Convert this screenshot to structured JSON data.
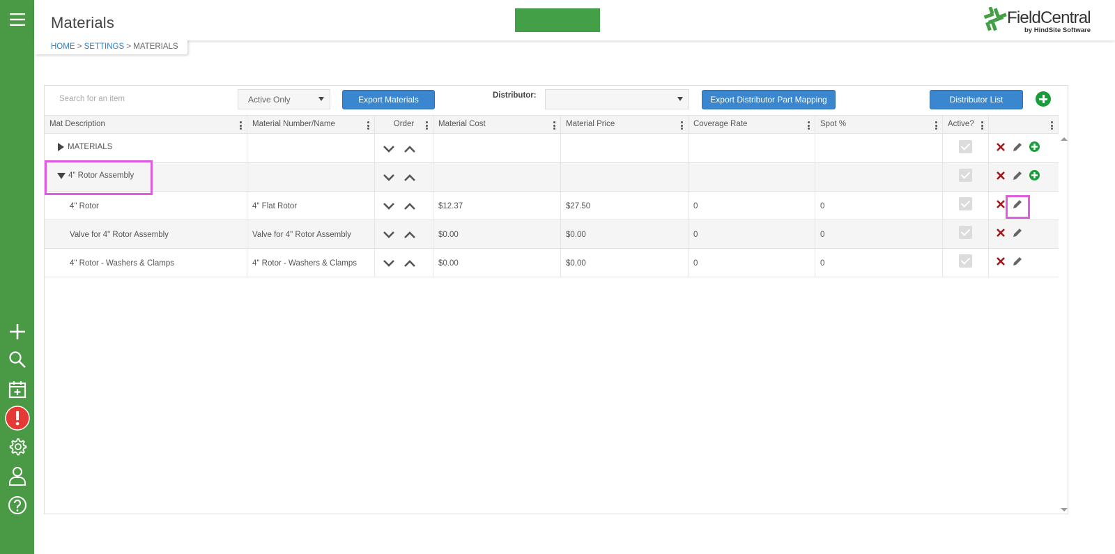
{
  "header": {
    "title": "Materials",
    "breadcrumb": {
      "home": "HOME",
      "sep1": ">",
      "settings": "SETTINGS",
      "sep2": ">",
      "current": "MATERIALS"
    },
    "logo": {
      "name": "FieldCentral",
      "sub": "by HindSite Software"
    }
  },
  "sidebar": {
    "top_icon": "hamburger-menu-icon",
    "items": [
      "add-icon",
      "search-icon",
      "calendar-add-icon",
      "alert-icon",
      "settings-gear-icon",
      "user-icon",
      "help-icon"
    ]
  },
  "toolbar": {
    "search_placeholder": "Search for an item",
    "filter_value": "Active Only",
    "export_materials": "Export Materials",
    "distributor_label": "Distributor:",
    "distributor_value": "",
    "export_mapping": "Export Distributor Part Mapping",
    "distributor_list": "Distributor List"
  },
  "columns": [
    "Mat Description",
    "Material Number/Name",
    "Order",
    "Material Cost",
    "Material Price",
    "Coverage Rate",
    "Spot %",
    "Active?",
    ""
  ],
  "rows": [
    {
      "description": "MATERIALS",
      "number": "",
      "cost": "",
      "price": "",
      "coverage": "",
      "spot": "",
      "expander": "collapsed",
      "can_add": true
    },
    {
      "description": "4\" Rotor Assembly",
      "number": "",
      "cost": "",
      "price": "",
      "coverage": "",
      "spot": "",
      "expander": "expanded",
      "can_add": true
    },
    {
      "description": "4\" Rotor",
      "number": "4\" Flat Rotor",
      "cost": "$12.37",
      "price": "$27.50",
      "coverage": "0",
      "spot": "0",
      "expander": "none",
      "can_add": false
    },
    {
      "description": "Valve for 4\" Rotor Assembly",
      "number": "Valve for 4\" Rotor Assembly",
      "cost": "$0.00",
      "price": "$0.00",
      "coverage": "0",
      "spot": "0",
      "expander": "none",
      "can_add": false
    },
    {
      "description": "4\" Rotor - Washers & Clamps",
      "number": "4\" Rotor - Washers & Clamps",
      "cost": "$0.00",
      "price": "$0.00",
      "coverage": "0",
      "spot": "0",
      "expander": "none",
      "can_add": false
    }
  ],
  "colors": {
    "sidebar": "#4a9a45",
    "button": "#3b87cf",
    "highlight": "#e05ce0",
    "delete": "#a01818",
    "add": "#199d3b"
  }
}
